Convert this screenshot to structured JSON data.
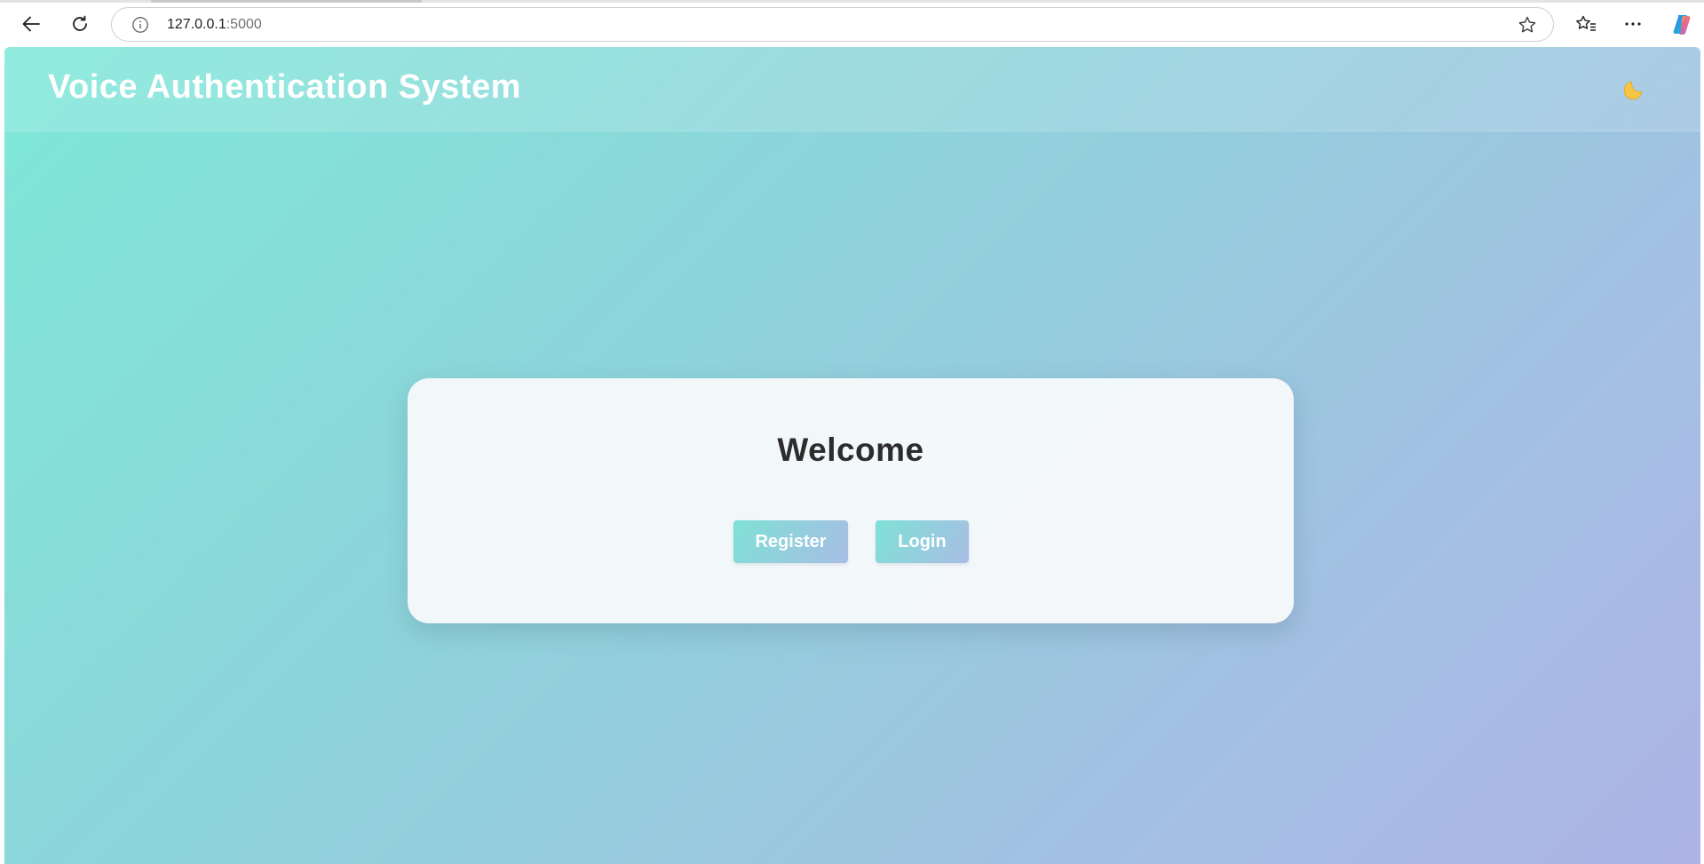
{
  "browser": {
    "url_host": "127.0.0.1",
    "url_port": ":5000",
    "icons": [
      "back-icon",
      "refresh-icon",
      "info-icon",
      "star-icon",
      "favorites-icon",
      "more-icon",
      "copilot-icon"
    ]
  },
  "header": {
    "title": "Voice Authentication System",
    "theme_toggle_icon": "moon-icon"
  },
  "card": {
    "title": "Welcome",
    "register_label": "Register",
    "login_label": "Login"
  },
  "colors": {
    "gradient_start": "#7ee8d8",
    "gradient_end": "#aeb3e6",
    "title_text": "#ffffff",
    "card_bg": "#f8fafb",
    "card_title": "#2c2c2c",
    "moon": "#f6c544"
  }
}
